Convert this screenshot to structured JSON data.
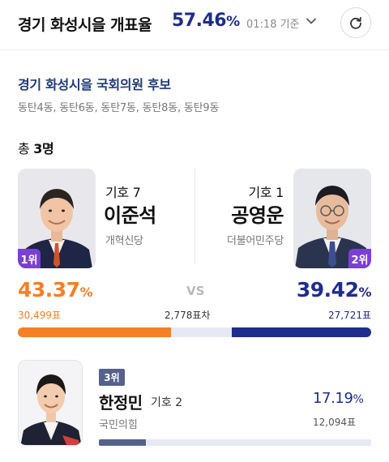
{
  "header": {
    "title": "경기 화성시을 개표율",
    "rate_value": "57.46",
    "rate_unit": "%",
    "time": "01:18 기준",
    "colors": {
      "accent": "#1f2d8c"
    }
  },
  "district": {
    "title": "경기 화성시을 국회의원 후보",
    "dongs": "동탄4동, 동탄6동, 동탄7동, 동탄8동, 동탄9동"
  },
  "total": {
    "prefix": "총 ",
    "count": "3명"
  },
  "candidates": [
    {
      "rank": "1위",
      "number": "기호 7",
      "name": "이준석",
      "party": "개혁신당",
      "pct": "43.37",
      "pct_unit": "%",
      "votes": "30,499표",
      "color": "#f57f25",
      "share": 43.37
    },
    {
      "rank": "2위",
      "number": "기호 1",
      "name": "공영운",
      "party": "더불어민주당",
      "pct": "39.42",
      "pct_unit": "%",
      "votes": "27,721표",
      "color": "#1f2d8c",
      "share": 39.42
    },
    {
      "rank": "3위",
      "number": "기호 2",
      "name": "한정민",
      "party": "국민의힘",
      "pct": "17.19",
      "pct_unit": "%",
      "votes": "12,094표",
      "color": "#55618d",
      "share": 17.19
    }
  ],
  "vs_label": "VS",
  "gap": "2,778표차",
  "icons": {
    "refresh": "refresh-icon",
    "dropdown": "chevron-down-icon"
  }
}
